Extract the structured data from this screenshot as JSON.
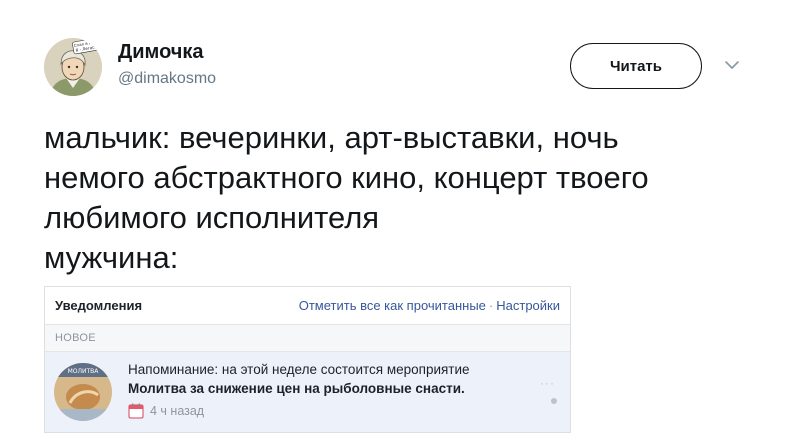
{
  "author": {
    "name": "Димочка",
    "handle": "@dimakosmo",
    "avatar_sign": [
      "Спал в приве.",
      "Я - Легасов."
    ]
  },
  "follow_button": {
    "label": "Читать"
  },
  "tweet": {
    "text": "мальчик: вечеринки, арт-выставки, ночь\nнемого абстрактного кино, концерт твоего\nлюбимого исполнителя\nмужчина:"
  },
  "notifications": {
    "title": "Уведомления",
    "mark_all_read": "Отметить все как прочитанные",
    "separator": "·",
    "settings": "Настройки",
    "section_new": "НОВОЕ",
    "item": {
      "thumb_banner": "МОЛИТВА",
      "line1": "Напоминание: на этой неделе состоится мероприятие",
      "line2": "Молитва за снижение цен на рыболовные снасти.",
      "time": "4 ч назад",
      "more": "···"
    }
  },
  "colors": {
    "link": "#365899",
    "muted": "#90949c",
    "highlight_bg": "#edf2fa",
    "handle": "#657786"
  }
}
